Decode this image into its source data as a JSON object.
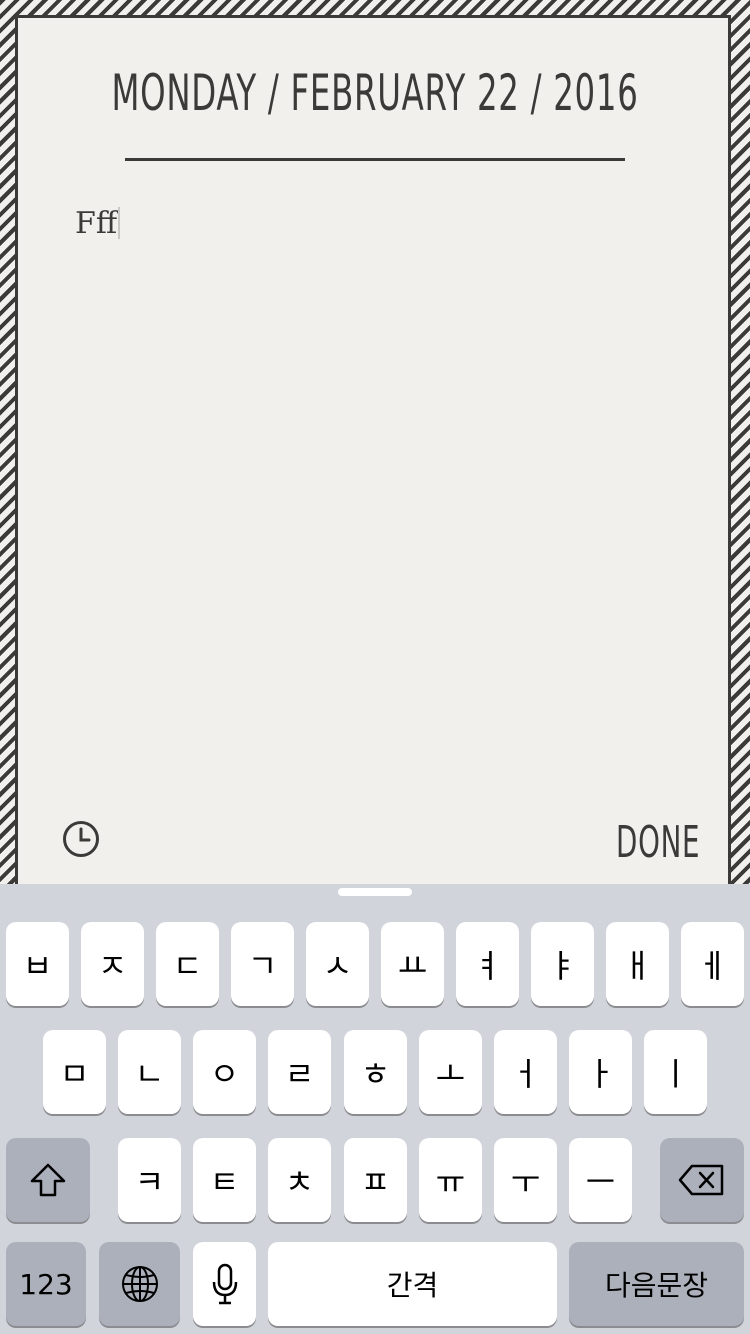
{
  "header": {
    "date": "MONDAY / FEBRUARY 22 / 2016"
  },
  "note": {
    "text": "Fff"
  },
  "footer": {
    "done_label": "DONE"
  },
  "icons": {
    "clock": "clock-icon",
    "shift": "shift-icon",
    "delete": "delete-icon",
    "globe": "globe-icon",
    "mic": "mic-icon"
  },
  "keyboard": {
    "row1": [
      "ㅂ",
      "ㅈ",
      "ㄷ",
      "ㄱ",
      "ㅅ",
      "ㅛ",
      "ㅕ",
      "ㅑ",
      "ㅐ",
      "ㅔ"
    ],
    "row2": [
      "ㅁ",
      "ㄴ",
      "ㅇ",
      "ㄹ",
      "ㅎ",
      "ㅗ",
      "ㅓ",
      "ㅏ",
      "ㅣ"
    ],
    "row3": [
      "ㅋ",
      "ㅌ",
      "ㅊ",
      "ㅍ",
      "ㅠ",
      "ㅜ",
      "ㅡ"
    ],
    "numbers_label": "123",
    "space_label": "간격",
    "return_label": "다음문장"
  },
  "colors": {
    "ink": "#3b3a38",
    "paper": "#f1f0ed",
    "keyboard_bg": "#d1d4da",
    "dark_key": "#abb0ba"
  }
}
